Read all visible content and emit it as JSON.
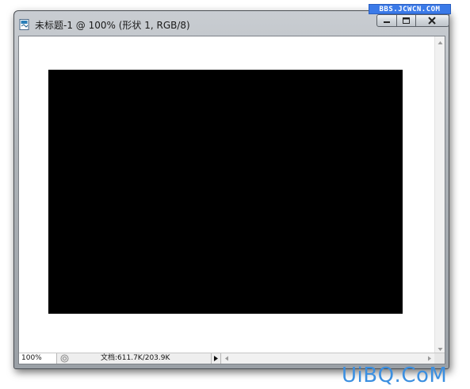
{
  "watermark_top": "BBS.JCWCN.COM",
  "window": {
    "title": "未标题-1 @ 100% (形状 1, RGB/8)",
    "controls": {
      "minimize": "minimize-icon",
      "maximize": "maximize-icon",
      "close": "close-icon"
    }
  },
  "canvas": {
    "background_color": "#ffffff",
    "shape_color": "#000000"
  },
  "statusbar": {
    "zoom": "100%",
    "doc_info": "文档:611.7K/203.9K"
  },
  "watermark_bottom": "UiBQ.CoM"
}
